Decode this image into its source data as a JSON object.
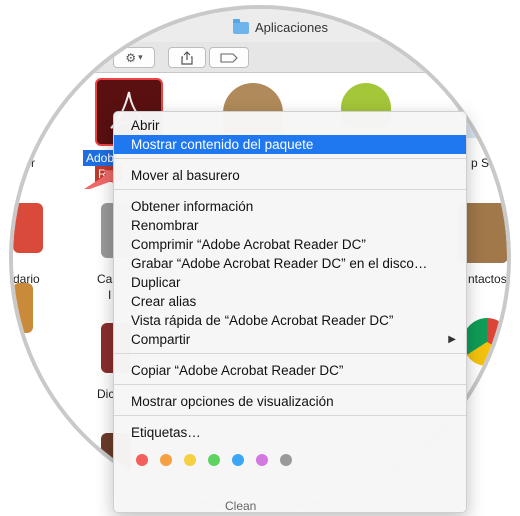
{
  "window": {
    "title": "Aplicaciones"
  },
  "background_labels": {
    "selected_app": "Adob",
    "selected_app_line2": "Rea",
    "left_partial_1": "r",
    "left_partial_2": "dario",
    "left_mid_1": "Ca",
    "left_mid_2": "I",
    "left_low": "Dic",
    "right_top": "p S",
    "right_mid": "ntactos",
    "bottom_partial": "Clean"
  },
  "menu": {
    "items": [
      {
        "label": "Abrir"
      },
      {
        "label": "Mostrar contenido del paquete",
        "highlighted": true
      },
      {
        "label": "Mover al basurero"
      },
      {
        "label": "Obtener información"
      },
      {
        "label": "Renombrar"
      },
      {
        "label": "Comprimir “Adobe Acrobat Reader DC”"
      },
      {
        "label": "Grabar “Adobe Acrobat Reader DC” en el disco…"
      },
      {
        "label": "Duplicar"
      },
      {
        "label": "Crear alias"
      },
      {
        "label": "Vista rápida de “Adobe Acrobat Reader DC”"
      },
      {
        "label": "Compartir",
        "has_submenu": true
      },
      {
        "label": "Copiar “Adobe Acrobat Reader DC”"
      },
      {
        "label": "Mostrar opciones de visualización"
      },
      {
        "label": "Etiquetas…"
      }
    ],
    "tag_colors": [
      "#f25f5c",
      "#f5a142",
      "#f5d142",
      "#5fd35f",
      "#3aa6f5",
      "#d278e0",
      "#9a9a9a"
    ]
  },
  "icons": {
    "gear": "gear-icon",
    "share": "share-icon",
    "tag": "tag-icon",
    "submenu": "chevron-right-icon"
  },
  "colors": {
    "highlight": "#1f78f0",
    "selection": "#1d6fe0",
    "arrow": "#f06a6a"
  }
}
